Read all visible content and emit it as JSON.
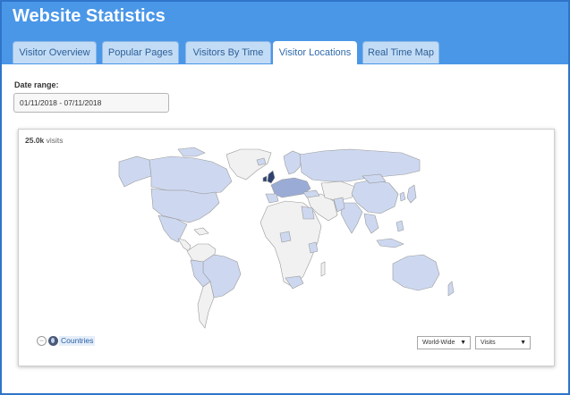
{
  "header": {
    "title": "Website Statistics"
  },
  "tabs": [
    {
      "label": "Visitor Overview",
      "active": false
    },
    {
      "label": "Popular Pages",
      "active": false
    },
    {
      "label": "Visitors By Time",
      "active": false
    },
    {
      "label": "Visitor Locations",
      "active": true
    },
    {
      "label": "Real Time Map",
      "active": false
    }
  ],
  "date_range": {
    "label": "Date range:",
    "value": "01/11/2018 - 07/11/2018"
  },
  "map": {
    "total_value": "25.0k",
    "total_unit": "visits",
    "legend_link": "Countries",
    "region_select": "World-Wide",
    "metric_select": "Visits",
    "colors": {
      "no_data": "#f1f1f1",
      "low": "#cdd8f0",
      "medium": "#9aacd6",
      "high": "#2e4272",
      "border": "#9a9a9a"
    }
  },
  "colors": {
    "header_bg": "#4a97e8",
    "frame_border": "#2f74c9",
    "tab_bg": "#c3dcf6",
    "tab_text": "#2d5f96"
  }
}
